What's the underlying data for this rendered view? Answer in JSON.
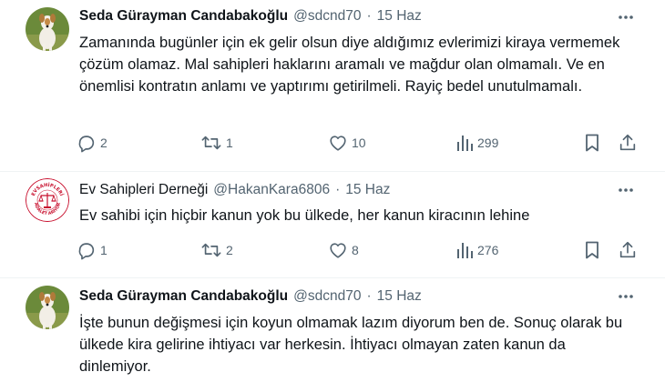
{
  "tweets": [
    {
      "author": "Seda Gürayman Candabakoğlu",
      "handle": "@sdcnd70",
      "date": "15 Haz",
      "text": "Zamanında bugünler için ek gelir olsun diye aldığımız evlerimizi kiraya vermemek çözüm olamaz. Mal sahipleri haklarını aramalı ve mağdur olan olmamalı. Ve en önemlisi kontratın anlamı ve yaptırımı getirilmeli. Rayiç bedel unutulmamalı.",
      "replies": "2",
      "retweets": "1",
      "likes": "10",
      "views": "299",
      "avatar_icon": "dog-avatar-icon"
    },
    {
      "author": "Ev Sahipleri Derneği",
      "handle": "@HakanKara6806",
      "date": "15 Haz",
      "text": "Ev sahibi için hiçbir kanun yok bu ülkede, her kanun kiracının lehine",
      "replies": "1",
      "retweets": "2",
      "likes": "8",
      "views": "276",
      "avatar_icon": "association-logo-icon"
    },
    {
      "author": "Seda Gürayman Candabakoğlu",
      "handle": "@sdcnd70",
      "date": "15 Haz",
      "text": "İşte bunun değişmesi için koyun olmamak lazım diyorum ben de. Sonuç olarak bu ülkede kira gelirine ihtiyacı var herkesin. İhtiyacı olmayan zaten kanun da dinlemiyor.",
      "avatar_icon": "dog-avatar-icon"
    }
  ],
  "logo_text": "EVSAHİPLERİ ADALET ARIYOR",
  "colors": {
    "text_primary": "#0f1419",
    "text_secondary": "#536471",
    "divider": "#eff3f4",
    "logo_red": "#c8102e"
  }
}
